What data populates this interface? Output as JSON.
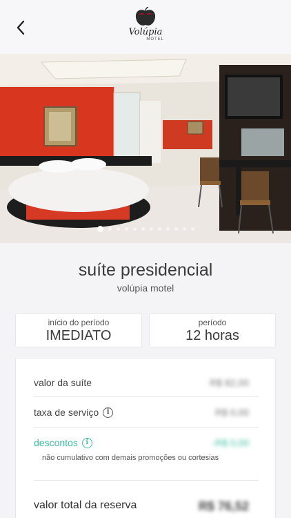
{
  "header": {
    "back_icon": "chevron-left-icon",
    "logo": {
      "name": "Volúpia",
      "sub": "MOTEL",
      "icon": "apple-logo-icon",
      "accent": "#c8102e"
    }
  },
  "gallery": {
    "total_images": 12,
    "active_index": 1
  },
  "suite": {
    "title": "suíte presidencial",
    "motel": "volúpia motel"
  },
  "period_start": {
    "label": "início do período",
    "value": "IMEDIATO"
  },
  "period": {
    "label": "período",
    "value": "12 horas"
  },
  "pricing": {
    "suite_value": {
      "label": "valor da suíte",
      "value": "R$ 82,00"
    },
    "service_fee": {
      "label": "taxa de serviço",
      "value": "R$ 0,00",
      "icon": "info-icon"
    },
    "discounts": {
      "label": "descontos",
      "value": "-R$ 0,00",
      "icon": "info-icon",
      "note": "não cumulativo com demais promoções ou cortesias",
      "color": "#3bbfa0"
    },
    "total": {
      "label": "valor total da reserva",
      "value": "R$ 76,52"
    }
  }
}
